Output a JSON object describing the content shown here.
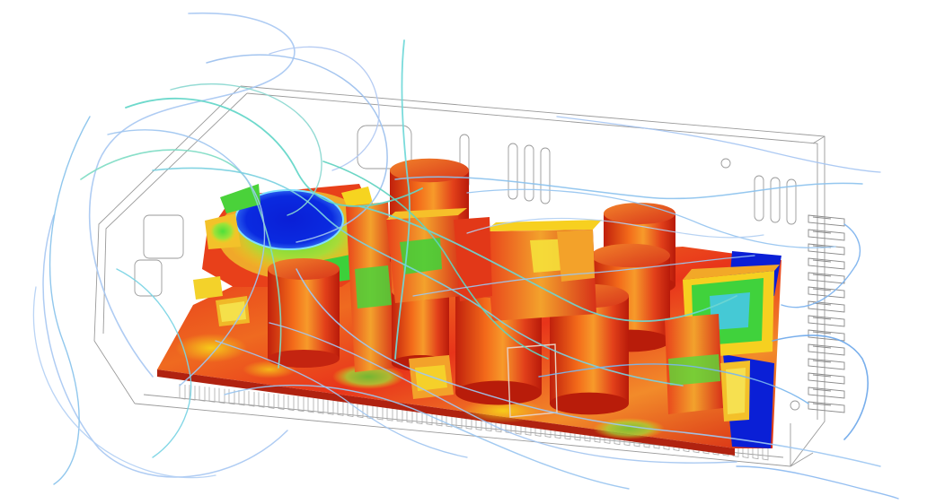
{
  "scene": {
    "subject": "",
    "colors": {
      "background": "#ffffff",
      "hot": "#e02a10",
      "warm": "#f06a18",
      "mid": "#f5d418",
      "cool": "#3fd23a",
      "cold": "#0a1fd6",
      "streamline_light": "#9ec4f0",
      "streamline_cyan": "#6fe0d8",
      "wireframe": "#9a9a9a"
    }
  }
}
